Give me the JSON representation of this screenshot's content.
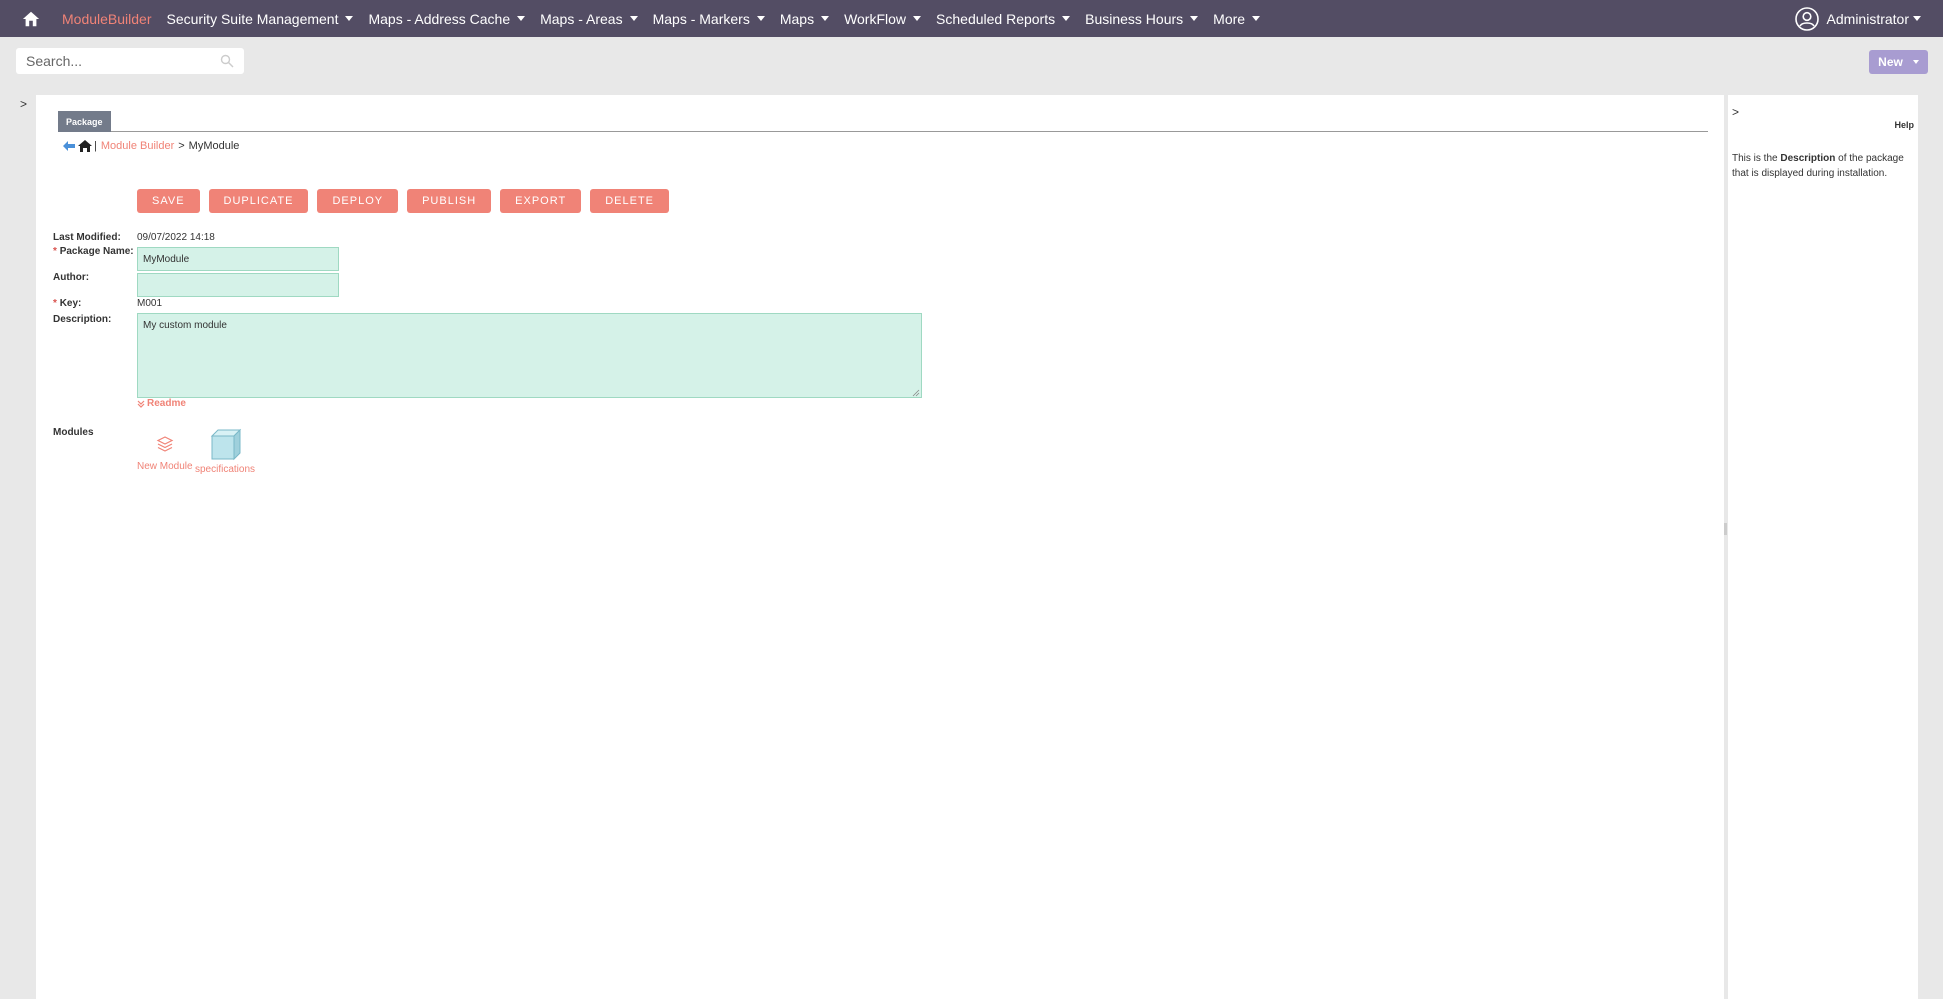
{
  "nav": {
    "brand": "ModuleBuilder",
    "items": [
      {
        "label": "Security Suite Management"
      },
      {
        "label": "Maps - Address Cache"
      },
      {
        "label": "Maps - Areas"
      },
      {
        "label": "Maps - Markers"
      },
      {
        "label": "Maps"
      },
      {
        "label": "WorkFlow"
      },
      {
        "label": "Scheduled Reports"
      },
      {
        "label": "Business Hours"
      },
      {
        "label": "More"
      }
    ],
    "user": "Administrator"
  },
  "search": {
    "placeholder": "Search..."
  },
  "new_button": "New",
  "toggles": {
    "left": ">",
    "right": ">"
  },
  "tab": "Package",
  "breadcrumb": {
    "separator": "|",
    "link": "Module Builder",
    "arrow": ">",
    "current": "MyModule"
  },
  "buttons": [
    "SAVE",
    "DUPLICATE",
    "DEPLOY",
    "PUBLISH",
    "EXPORT",
    "DELETE"
  ],
  "form": {
    "last_modified_label": "Last Modified:",
    "last_modified_value": "09/07/2022 14:18",
    "package_name_label": "Package Name:",
    "package_name_value": "MyModule",
    "author_label": "Author:",
    "author_value": "",
    "key_label": "Key:",
    "key_value": "M001",
    "description_label": "Description:",
    "description_value": "My custom module",
    "required_mark": "*",
    "readme_label": "Readme"
  },
  "modules": {
    "label": "Modules",
    "items": [
      {
        "label": "New Module",
        "icon": "new-module-icon"
      },
      {
        "label": "specifications",
        "icon": "cube-icon"
      }
    ]
  },
  "help": {
    "title": "Help",
    "text_prefix": "This is the ",
    "text_bold": "Description",
    "text_suffix": " of the package that is displayed during installation."
  },
  "colors": {
    "nav_bg": "#534d64",
    "accent": "#f08377",
    "new_button": "#a89cd1",
    "input_bg": "#d5f2e8"
  }
}
